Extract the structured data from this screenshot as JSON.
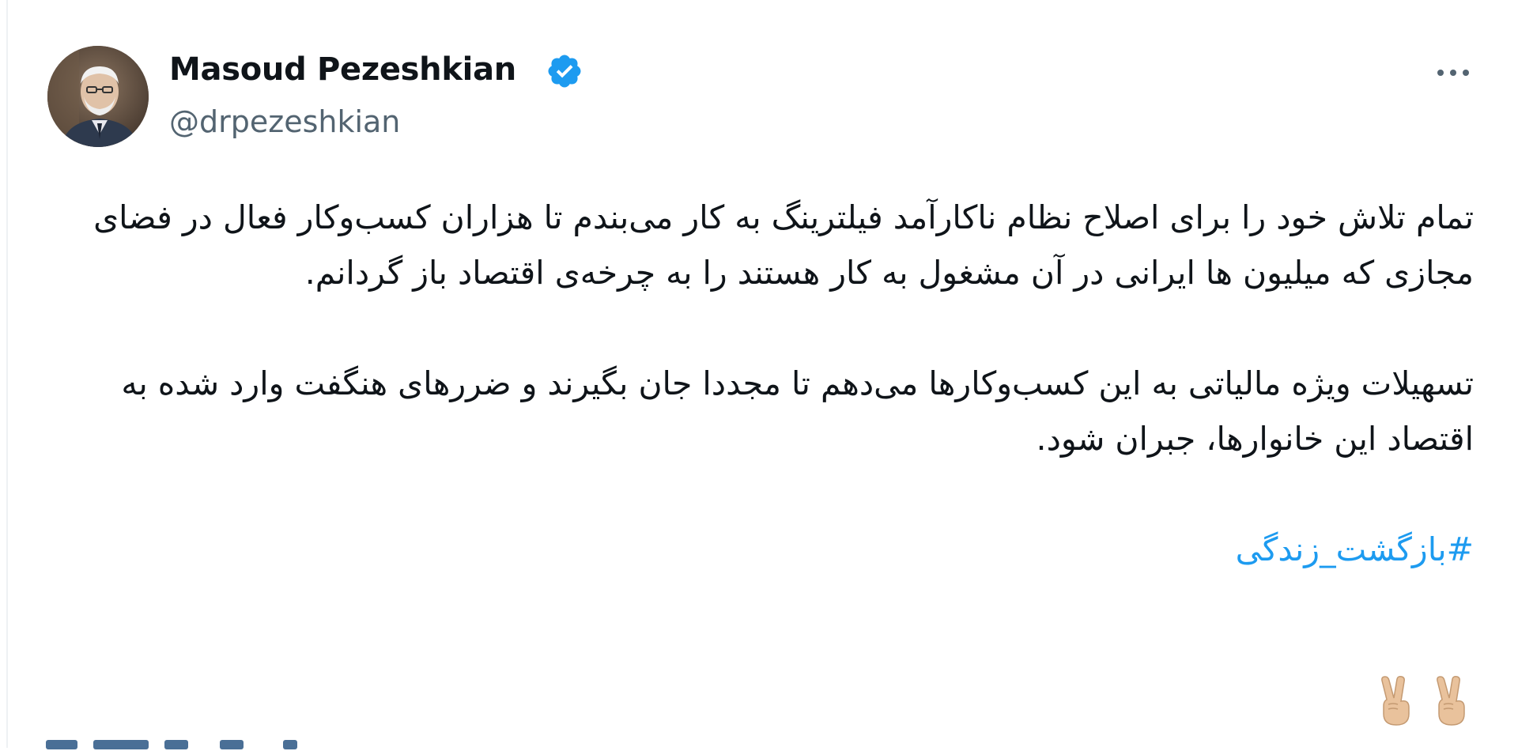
{
  "tweet": {
    "author_name": "Masoud Pezeshkian",
    "handle": "@drpezeshkian",
    "verified_icon": "verified-badge-icon",
    "more_icon": "more-options-icon",
    "paragraph1": "تمام تلاش خود را برای اصلاح نظام ناکارآمد فیلترینگ به کار می‌بندم تا هزاران کسب‌وکار فعال در فضای مجازی که میلیون ها ایرانی در آن مشغول به کار هستند را به چرخه‌ی اقتصاد باز گردانم.",
    "paragraph2": "تسهیلات ویژه مالیاتی  به این کسب‌وکارها می‌دهم تا مجددا جان بگیرند و ضررهای هنگفت وارد شده به اقتصاد این خانوارها، جبران شود.",
    "hashtag": "#بازگشت_زندگی",
    "emoji_icons": [
      "victory-hand-icon",
      "victory-hand-icon"
    ]
  },
  "colors": {
    "text": "#0f1419",
    "secondary": "#536471",
    "link": "#1d9bf0",
    "verified": "#1d9bf0"
  }
}
